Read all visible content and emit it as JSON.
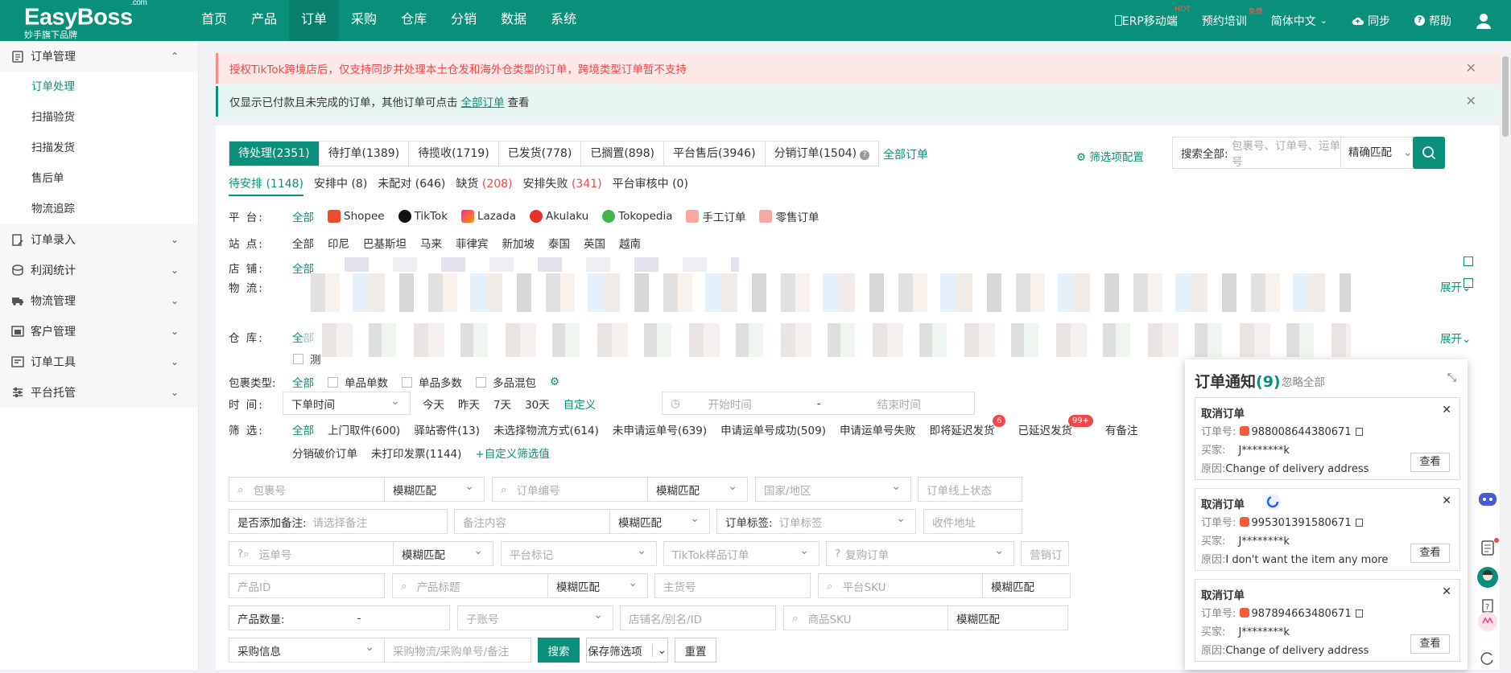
{
  "brand": {
    "name": "EasyBoss",
    "dotcom": ".com",
    "slogan": "妙手旗下品牌"
  },
  "nav": [
    "首页",
    "产品",
    "订单",
    "采购",
    "仓库",
    "分销",
    "数据",
    "系统"
  ],
  "nav_active": "订单",
  "topright": {
    "erp": "ERP移动端",
    "erp_badge": "HOT",
    "training": "预约培训",
    "training_badge": "免费",
    "lang": "简体中文",
    "sync": "同步",
    "help": "帮助"
  },
  "sidebar": {
    "order_mgmt": "订单管理",
    "items": [
      "订单处理",
      "扫描验货",
      "扫描发货",
      "售后单",
      "物流追踪"
    ],
    "groups": [
      "订单录入",
      "利润统计",
      "物流管理",
      "客户管理",
      "订单工具",
      "平台托管"
    ]
  },
  "alerts": {
    "red": "授权TikTok跨境店后，仅支持同步并处理本土仓发和海外仓类型的订单，跨境类型订单暂不支持",
    "green_pre": "仅显示已付款且未完成的订单，其他订单可点击",
    "green_link": "全部订单",
    "green_post": "查看"
  },
  "tabs": [
    "待处理(2351)",
    "待打单(1389)",
    "待揽收(1719)",
    "已发货(778)",
    "已搁置(898)",
    "平台售后(3946)",
    "分销订单(1504)"
  ],
  "all_orders": "全部订单",
  "filter_config": "筛选项配置",
  "search": {
    "label": "搜索全部:",
    "placeholder": "包裹号、订单号、运单号",
    "match": "精确匹配"
  },
  "subtabs": [
    {
      "label": "待安排 (1148)",
      "active": true
    },
    {
      "label": "安排中 (8)"
    },
    {
      "label": "未配对 (646)"
    },
    {
      "label_a": "缺货 ",
      "label_b": "(208)"
    },
    {
      "label_a": "安排失败 ",
      "label_b": "(341)"
    },
    {
      "label": "平台审核中 (0)"
    }
  ],
  "rows": {
    "platform_label": "平 台:",
    "platforms": [
      "全部",
      "Shopee",
      "TikTok",
      "Lazada",
      "Akulaku",
      "Tokopedia",
      "手工订单",
      "零售订单"
    ],
    "site_label": "站 点:",
    "sites": [
      "全部",
      "印尼",
      "巴基斯坦",
      "马来",
      "菲律宾",
      "新加坡",
      "泰国",
      "英国",
      "越南"
    ],
    "shop_label": "店 铺:",
    "logistics_label": "物 流:",
    "warehouse_label": "仓 库:",
    "all": "全部",
    "test": "测",
    "expand": "展开",
    "package_label": "包裹类型:",
    "package_opts": [
      "全部",
      "单品单数",
      "单品多数",
      "多品混包"
    ],
    "time_label": "时 间:",
    "time_select": "下单时间",
    "time_opts": [
      "今天",
      "昨天",
      "7天",
      "30天"
    ],
    "time_custom": "自定义",
    "time_start": "开始时间",
    "time_sep": "-",
    "time_end": "结束时间",
    "filter_label": "筛 选:",
    "filters": [
      "全部",
      "上门取件(600)",
      "驿站寄件(13)",
      "未选择物流方式(614)",
      "未申请运单号(639)",
      "申请运单号成功(509)",
      "申请运单号失败",
      "即将延迟发货",
      "已延迟发货",
      "有备注"
    ],
    "delay_badge": "6",
    "delayed_badge": "99+",
    "filters2": [
      "分销破价订单",
      "未打印发票(1144)"
    ],
    "custom_filter": "+自定义筛选值"
  },
  "form": {
    "package_no": "包裹号",
    "fuzzy": "模糊匹配",
    "order_no": "订单编号",
    "country": "国家/地区",
    "online_status": "订单线上状态",
    "has_note_label": "是否添加备注:",
    "has_note_ph": "请选择备注",
    "note_content": "备注内容",
    "tag_label": "订单标签:",
    "tag_ph": "订单标签",
    "address": "收件地址",
    "tracking_no": "运单号",
    "platform_mark": "平台标记",
    "tiktok_sample": "TikTok样品订单",
    "repurchase": "复购订单",
    "marketing": "营销订",
    "product_id": "产品ID",
    "product_title": "产品标题",
    "main_no": "主货号",
    "platform_sku": "平台SKU",
    "qty_label": "产品数量:",
    "qty_sep": "-",
    "sub_account": "子账号",
    "shop_name": "店铺名/别名/ID",
    "product_sku": "商品SKU",
    "purchase_info": "采购信息",
    "purchase_ph": "采购物流/采购单号/备注",
    "search_btn": "搜索",
    "save_filter": "保存筛选项",
    "reset": "重置"
  },
  "notifications": {
    "title": "订单通知",
    "count": "(9)",
    "ignore": "忽略全部",
    "order_label": "订单号:",
    "buyer_label": "买家:",
    "reason_label": "原因:",
    "view": "查看",
    "items": [
      {
        "title": "取消订单",
        "order": "988008644380671",
        "buyer": "J********k",
        "reason": "Change of delivery address"
      },
      {
        "title": "取消订单",
        "order": "995301391580671",
        "buyer": "J********k",
        "reason": "I don't want the item any more"
      },
      {
        "title": "取消订单",
        "order": "987894663480671",
        "buyer": "J********k",
        "reason": "Change of delivery address"
      }
    ]
  },
  "colors": {
    "brand": "#0a8f7a",
    "alert_red": "#f04848",
    "badge_red": "#f04848"
  }
}
